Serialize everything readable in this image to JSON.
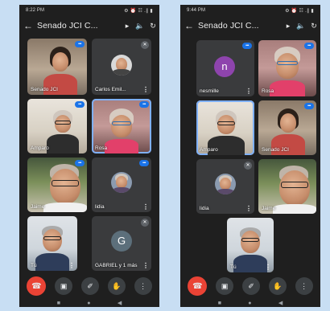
{
  "left": {
    "status_time": "8:22 PM",
    "status_time_extra": "• • •",
    "status_icons": "⚙ ⏰ ☷ .∥ ▮",
    "title": "Senado JCI C...",
    "tiles": [
      {
        "name": "Senado JCI"
      },
      {
        "name": "Carlos Emil..."
      },
      {
        "name": "Amparo"
      },
      {
        "name": "Rosa"
      },
      {
        "name": "Jaime"
      },
      {
        "name": "lidia"
      },
      {
        "name": "Tú"
      },
      {
        "name": "GABRIEL y 1 más",
        "avatar_letter": "G"
      }
    ]
  },
  "right": {
    "status_time": "9:44 PM",
    "status_time_extra": "• • •",
    "status_icons": "⚙ ⏰ ☷ .∥ ▮",
    "title": "Senado JCI C...",
    "tiles": [
      {
        "name": "nesmille",
        "avatar_letter": "n"
      },
      {
        "name": "Rosa"
      },
      {
        "name": "Amparo"
      },
      {
        "name": "Senado JCI"
      },
      {
        "name": "lidia"
      },
      {
        "name": "Jaime"
      },
      {
        "name": "Tú"
      }
    ]
  },
  "icons": {
    "back": "←",
    "arrow": "▸",
    "speaker": "🔈",
    "camera_switch": "↻",
    "menu": "⋮",
    "speaking": "•••",
    "muted": "✕",
    "end_call": "☎",
    "camera": "▣",
    "mic": "✐",
    "hand": "✋",
    "more": "⋮",
    "nav_square": "■",
    "nav_home": "●",
    "nav_back": "◀"
  },
  "colors": {
    "end_call": "#ea4335",
    "speaking_badge": "#1a73e8",
    "avatar_purple": "#8e44ad",
    "avatar_slate": "#5c6f7b"
  }
}
